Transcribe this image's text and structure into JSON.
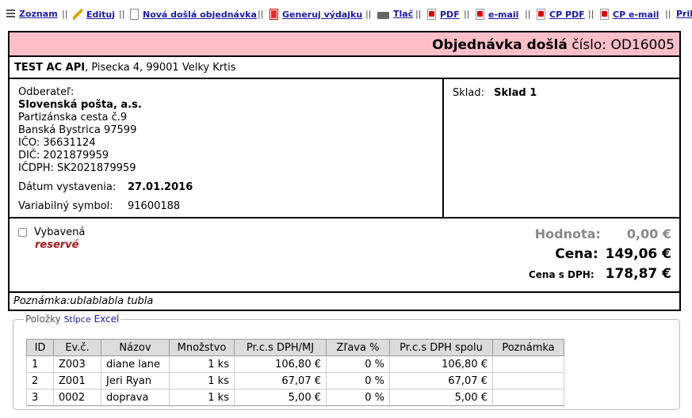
{
  "toolbar": {
    "items": [
      {
        "label": "Zoznam",
        "icon": "list-icon"
      },
      {
        "label": "Edituj",
        "icon": "pencil-icon"
      },
      {
        "label": "Nová došlá objednávka",
        "icon": "new-document-icon"
      },
      {
        "label": "Generuj výdajku",
        "icon": "generate-icon"
      },
      {
        "label": "Tlač",
        "icon": "printer-icon"
      },
      {
        "label": "PDF",
        "icon": "pdf-icon"
      },
      {
        "label": "e-mail",
        "icon": "pdf-email-icon"
      },
      {
        "label": "CP PDF",
        "icon": "pdf-icon"
      },
      {
        "label": "CP e-mail",
        "icon": "pdf-email-icon"
      },
      {
        "label": "Pril"
      }
    ],
    "separator": "||"
  },
  "header": {
    "title": "Objednávka došlá",
    "number_label": "číslo:",
    "number": "OD16005",
    "bg_color": "#ffbfc8"
  },
  "supplier": {
    "name": "TEST AC API",
    "address": ", Pisecka 4, 99001 Velky Krtis"
  },
  "customer": {
    "label": "Odberateľ:",
    "name": "Slovenská pošta, a.s.",
    "street": "Partizánska cesta č.9",
    "city": "Banská Bystrica 97599",
    "ico": "IČO: 36631124",
    "dic": "DIČ: 2021879959",
    "icdph": "IČDPH: SK2021879959"
  },
  "dates": {
    "issue_label": "Dátum vystavenia:",
    "issue_value": "27.01.2016",
    "vs_label": "Variabilný symbol:",
    "vs_value": "91600188"
  },
  "warehouse": {
    "label": "Sklad:",
    "value": "Sklad 1"
  },
  "status": {
    "checkbox_label": "Vybavená",
    "reserve": "reservé",
    "reserve_color": "#a51b1b"
  },
  "totals": {
    "value_label": "Hodnota:",
    "value": "0,00 €",
    "price_label": "Cena:",
    "price": "149,06 €",
    "price_vat_label": "Cena s DPH:",
    "price_vat": "178,87 €"
  },
  "note": "Poznámka:ublablabla tubla",
  "items": {
    "legend": "Položky",
    "link_columns": "Stĺpce",
    "link_excel": "Excel",
    "columns": [
      "ID",
      "Ev.č.",
      "Názov",
      "Množstvo",
      "Pr.c.s DPH/MJ",
      "Zľava %",
      "Pr.c.s DPH spolu",
      "Poznámka"
    ],
    "rows": [
      {
        "id": "1",
        "ev": "Z003",
        "name": "diane lane",
        "qty": "1 ks",
        "unit_price": "106,80 €",
        "discount": "0 %",
        "total": "106,80 €",
        "note": ""
      },
      {
        "id": "2",
        "ev": "Z001",
        "name": "Jeri Ryan",
        "qty": "1 ks",
        "unit_price": "67,07 €",
        "discount": "0 %",
        "total": "67,07 €",
        "note": ""
      },
      {
        "id": "3",
        "ev": "0002",
        "name": "doprava",
        "qty": "1 ks",
        "unit_price": "5,00 €",
        "discount": "0 %",
        "total": "5,00 €",
        "note": ""
      }
    ]
  }
}
